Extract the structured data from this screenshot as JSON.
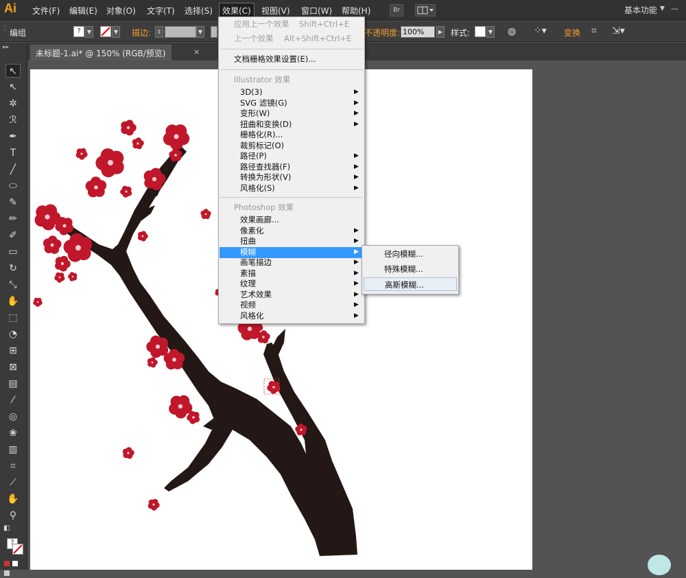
{
  "app": {
    "logo": "Ai",
    "workspace": "基本功能"
  },
  "menubar": {
    "items": [
      "文件(F)",
      "编辑(E)",
      "对象(O)",
      "文字(T)",
      "选择(S)",
      "效果(C)",
      "视图(V)",
      "窗口(W)",
      "帮助(H)"
    ],
    "active": "效果(C)",
    "bridge_label": "Br"
  },
  "control": {
    "mode": "编组",
    "stroke_label": "描边:",
    "opacity_label": "不透明度:",
    "opacity_value": "100%",
    "style_label": "样式:",
    "transform_label": "变换"
  },
  "document": {
    "tab_title": "未标题-1.ai* @ 150% (RGB/预览)",
    "close": "×"
  },
  "effect_menu": {
    "apply_last": {
      "label": "应用上一个效果",
      "shortcut": "Shift+Ctrl+E"
    },
    "last_effect": {
      "label": "上一个效果",
      "shortcut": "Alt+Shift+Ctrl+E"
    },
    "raster_settings": "文档栅格效果设置(E)...",
    "illustrator_header": "Illustrator 效果",
    "illustrator_items": [
      "3D(3)",
      "SVG 滤镜(G)",
      "变形(W)",
      "扭曲和变换(D)",
      "栅格化(R)...",
      "裁剪标记(O)",
      "路径(P)",
      "路径查找器(F)",
      "转换为形状(V)",
      "风格化(S)"
    ],
    "photoshop_header": "Photoshop 效果",
    "photoshop_items": [
      "效果画廊...",
      "像素化",
      "扭曲",
      "模糊",
      "画笔描边",
      "素描",
      "纹理",
      "艺术效果",
      "视频",
      "风格化"
    ],
    "highlighted": "模糊"
  },
  "blur_submenu": {
    "items": [
      "径向模糊...",
      "特殊模糊...",
      "高斯模糊..."
    ],
    "hovered": "高斯模糊..."
  },
  "colors": {
    "blossom": "#c0172b",
    "branch": "#231815",
    "highlight": "#3399ff",
    "logo": "#f7a21b"
  }
}
